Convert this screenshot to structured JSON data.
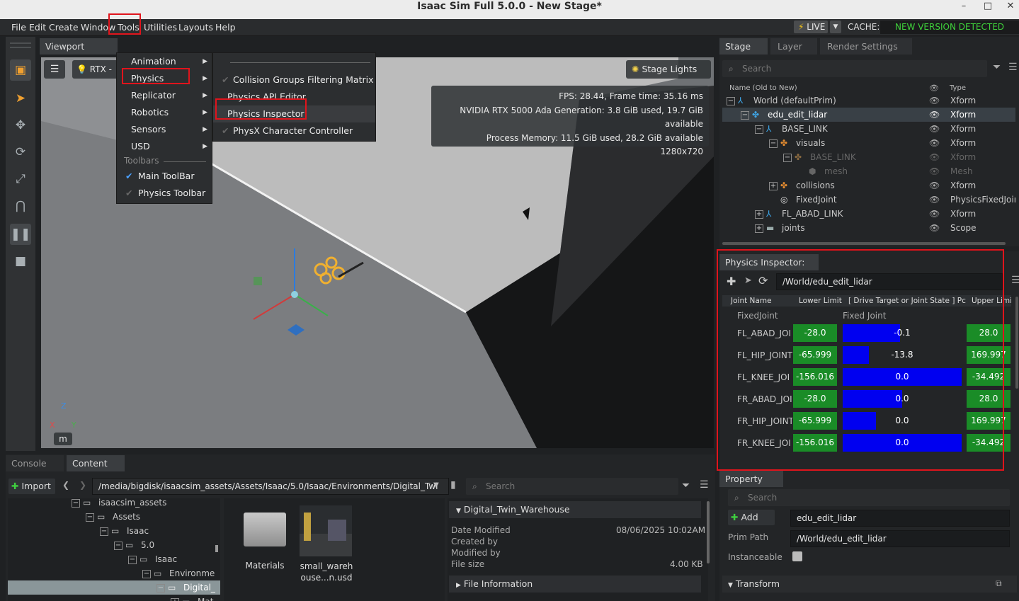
{
  "window": {
    "title": "Isaac Sim Full 5.0.0 - New Stage*",
    "minimize": "–",
    "maximize": "□",
    "close": "✕"
  },
  "menubar": {
    "items": [
      "File",
      "Edit",
      "Create",
      "Window",
      "Tools",
      "Utilities",
      "Layouts",
      "Help"
    ],
    "live": "LIVE",
    "cache": "CACHE:",
    "notice": "NEW VERSION DETECTED"
  },
  "tools_menu": {
    "items": [
      "Animation",
      "Physics",
      "Replicator",
      "Robotics",
      "Sensors",
      "USD"
    ],
    "section": "Toolbars",
    "toolbars": [
      "Main ToolBar",
      "Physics Toolbar"
    ]
  },
  "physics_submenu": {
    "items": [
      "Collision Groups Filtering Matrix",
      "Physics API Editor",
      "Physics Inspector",
      "PhysX Character Controller"
    ]
  },
  "viewport": {
    "tab": "Viewport",
    "renderer": "RTX -",
    "stage_lights": "Stage Lights",
    "stats": [
      "FPS: 28.44, Frame time: 35.16 ms",
      "NVIDIA RTX 5000 Ada Generation: 3.8 GiB used, 19.7 GiB available",
      "Process Memory: 11.5 GiB used, 28.2 GiB available",
      "1280x720"
    ],
    "unit": "m",
    "axes": {
      "z": "Z",
      "x": "X",
      "y": "Y"
    }
  },
  "stage": {
    "tabs": [
      "Stage",
      "Layer",
      "Render Settings"
    ],
    "search_placeholder": "Search",
    "col_name": "Name (Old to New)",
    "col_type": "Type",
    "rows": [
      {
        "name": "World (defaultPrim)",
        "type": "Xform"
      },
      {
        "name": "edu_edit_lidar",
        "type": "Xform"
      },
      {
        "name": "BASE_LINK",
        "type": "Xform"
      },
      {
        "name": "visuals",
        "type": "Xform"
      },
      {
        "name": "BASE_LINK",
        "type": "Xform"
      },
      {
        "name": "mesh",
        "type": "Mesh"
      },
      {
        "name": "collisions",
        "type": "Xform"
      },
      {
        "name": "FixedJoint",
        "type": "PhysicsFixedJoin"
      },
      {
        "name": "FL_ABAD_LINK",
        "type": "Xform"
      },
      {
        "name": "joints",
        "type": "Scope"
      }
    ]
  },
  "inspector": {
    "title": "Physics Inspector:",
    "path": "/World/edu_edit_lidar",
    "cols": [
      "Joint Name",
      "Lower Limit",
      "[ Drive Target or Joint State ] Pc",
      "Upper Limi"
    ],
    "group_name": "FixedJoint",
    "group_type": "Fixed Joint",
    "rows": [
      {
        "name": "FL_ABAD_JOI",
        "lower": "-28.0",
        "value": "-0.1",
        "fill": 0.48,
        "upper": "28.0"
      },
      {
        "name": "FL_HIP_JOINT",
        "lower": "-65.999",
        "value": "-13.8",
        "fill": 0.22,
        "upper": "169.997"
      },
      {
        "name": "FL_KNEE_JOI",
        "lower": "-156.016",
        "value": "0.0",
        "fill": 1.0,
        "upper": "-34.492"
      },
      {
        "name": "FR_ABAD_JOI",
        "lower": "-28.0",
        "value": "0.0",
        "fill": 0.5,
        "upper": "28.0"
      },
      {
        "name": "FR_HIP_JOINT",
        "lower": "-65.999",
        "value": "0.0",
        "fill": 0.28,
        "upper": "169.997"
      },
      {
        "name": "FR_KNEE_JOI",
        "lower": "-156.016",
        "value": "0.0",
        "fill": 1.0,
        "upper": "-34.492"
      }
    ]
  },
  "bottom": {
    "tabs": [
      "Console",
      "Content"
    ],
    "import": "Import",
    "path": "/media/bigdisk/isaacsim_assets/Assets/Isaac/5.0/Isaac/Environments/Digital_Twi",
    "search_placeholder": "Search",
    "tree": [
      "isaacsim_assets",
      "Assets",
      "Isaac",
      "5.0",
      "Isaac",
      "Environme",
      "Digital_",
      "Mat"
    ],
    "files": [
      {
        "name": "Materials"
      },
      {
        "name": "small_wareh\nouse...n.usd"
      }
    ],
    "details": {
      "header": "Digital_Twin_Warehouse",
      "date_label": "Date Modified",
      "date": "08/06/2025 10:02AM",
      "created": "Created by",
      "modified": "Modified by",
      "size_label": "File size",
      "size": "4.00 KB",
      "fileinfo": "File Information"
    }
  },
  "property": {
    "tab": "Property",
    "search_placeholder": "Search",
    "add": "Add",
    "name_value": "edu_edit_lidar",
    "prim_path_label": "Prim Path",
    "prim_path": "/World/edu_edit_lidar",
    "instanceable": "Instanceable",
    "transform": "Transform"
  }
}
